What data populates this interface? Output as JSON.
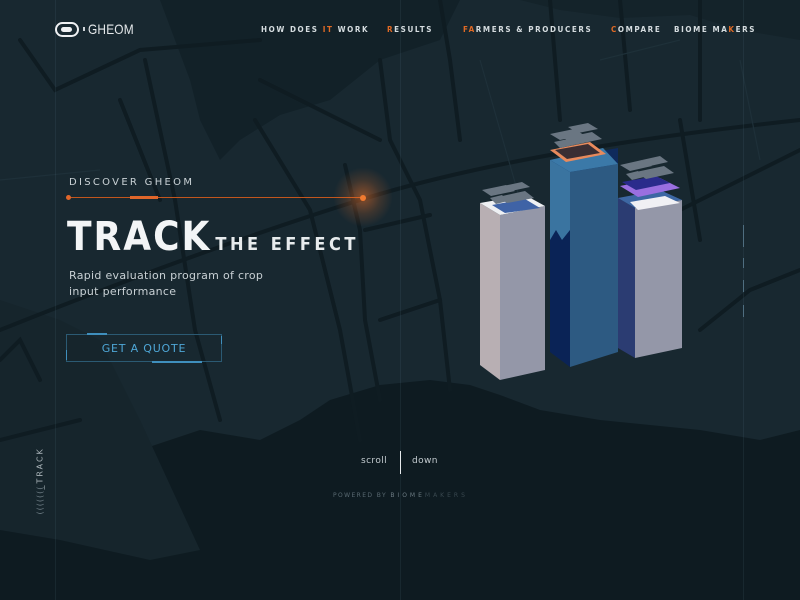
{
  "header": {
    "logo_text": "GHEOM",
    "nav": [
      {
        "prefix": "HOW DOES ",
        "highlight": "I",
        "rest": "T WORK",
        "hl_second": true
      },
      {
        "prefix": "",
        "highlight": "R",
        "rest": "ESULTS"
      },
      {
        "prefix": "F",
        "highlight": "A",
        "rest": "RMERS & PRODUCERS"
      },
      {
        "prefix": "",
        "highlight": "C",
        "rest": "OMPARE"
      },
      {
        "prefix": "BIOME MA",
        "highlight": "K",
        "rest": "ERS"
      }
    ]
  },
  "hero": {
    "kicker": "DISCOVER GHEOM",
    "title_big": "TRACK",
    "title_small": "THE EFFECT",
    "subtitle": "Rapid evaluation program of crop input performance",
    "cta_label": "GET A QUOTE"
  },
  "side": {
    "label": "_TRACK",
    "brackets": "((((((("
  },
  "scroll": {
    "left": "scroll",
    "right": "down"
  },
  "footer": {
    "powered_prefix": "POWERED BY ",
    "brand_part1": "BIOME",
    "brand_part2": "MAKERS"
  },
  "colors": {
    "background": "#162329",
    "accent_orange": "#e0662a",
    "accent_blue": "#4ea6d6"
  },
  "illustration": {
    "name": "3D bar towers",
    "bars": [
      {
        "name": "left",
        "top_plate": "#4466a8"
      },
      {
        "name": "center",
        "top_plate": "#e88a5c"
      },
      {
        "name": "right",
        "top_plate": "#9a6fe0"
      }
    ]
  }
}
